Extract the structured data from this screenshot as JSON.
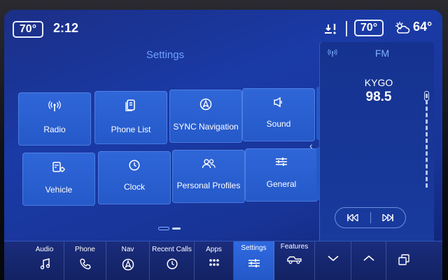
{
  "status_bar": {
    "driver_temp": "70°",
    "time": "2:12",
    "passenger_temp": "70°",
    "outside_temp": "64°"
  },
  "settings": {
    "title": "Settings",
    "tiles": [
      {
        "label": "Radio",
        "icon": "radio-antenna-icon"
      },
      {
        "label": "Phone List",
        "icon": "phone-list-icon"
      },
      {
        "label": "SYNC Navigation",
        "icon": "navigation-arrow-icon"
      },
      {
        "label": "Sound",
        "icon": "speaker-icon"
      },
      {
        "label": "Vehicle",
        "icon": "vehicle-settings-icon"
      },
      {
        "label": "Clock",
        "icon": "clock-icon"
      },
      {
        "label": "Personal Profiles",
        "icon": "profiles-icon"
      },
      {
        "label": "General",
        "icon": "sliders-icon"
      }
    ],
    "page_count": 2,
    "current_page": 1
  },
  "radio_panel": {
    "band": "FM",
    "station_name": "KYGO",
    "frequency": "98.5"
  },
  "bottom_nav": {
    "items": [
      {
        "label": "Audio",
        "icon": "music-note-icon"
      },
      {
        "label": "Phone",
        "icon": "phone-icon"
      },
      {
        "label": "Nav",
        "icon": "navigation-arrow-icon"
      },
      {
        "label": "Recent Calls",
        "icon": "recent-clock-icon"
      },
      {
        "label": "Apps",
        "icon": "apps-grid-icon"
      },
      {
        "label": "Settings",
        "icon": "sliders-icon",
        "active": true
      },
      {
        "label": "Features",
        "icon": "truck-icon"
      }
    ]
  },
  "colors": {
    "accent": "#6ea0ff",
    "tile": "#2a60d0",
    "active_nav": "#2f6ae0"
  }
}
